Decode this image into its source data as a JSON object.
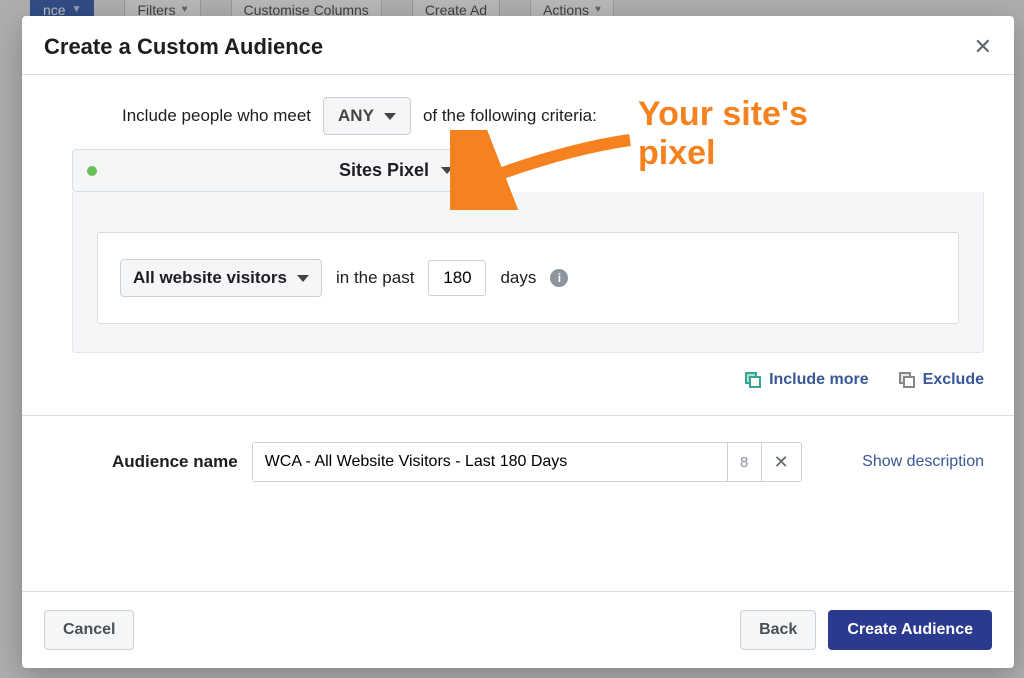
{
  "bg_toolbar": {
    "filters": "Filters",
    "customise": "Customise Columns",
    "create_ad": "Create Ad",
    "actions": "Actions"
  },
  "modal": {
    "title": "Create a Custom Audience",
    "include_prefix": "Include people who meet",
    "any_label": "ANY",
    "include_suffix": "of the following criteria:",
    "pixel_label": "Sites Pixel",
    "visitors_label": "All website visitors",
    "in_past": "in the past",
    "days_value": "180",
    "days_word": "days",
    "include_more": "Include more",
    "exclude": "Exclude",
    "audience_name_label": "Audience name",
    "audience_name_value": "WCA - All Website Visitors - Last 180 Days",
    "audience_name_remaining": "8",
    "show_description": "Show description"
  },
  "footer": {
    "cancel": "Cancel",
    "back": "Back",
    "create": "Create Audience"
  },
  "annotation": {
    "text": "Your site's\npixel"
  }
}
